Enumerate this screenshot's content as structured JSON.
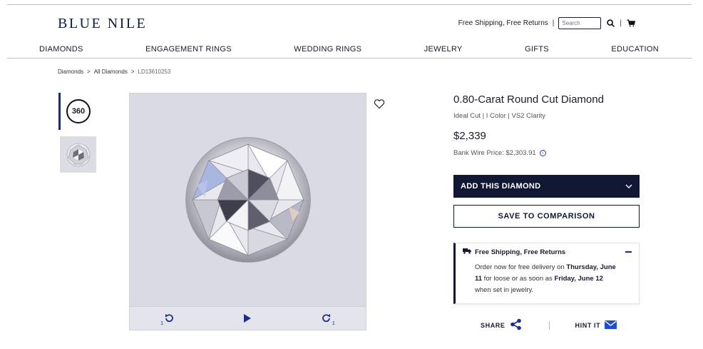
{
  "header": {
    "logo": "BLUE NILE",
    "shipping_link": "Free Shipping, Free Returns",
    "separator": "|",
    "search_placeholder": "Search"
  },
  "nav": {
    "items": [
      "DIAMONDS",
      "ENGAGEMENT RINGS",
      "WEDDING RINGS",
      "JEWELRY",
      "GIFTS",
      "EDUCATION"
    ]
  },
  "breadcrumb": {
    "items": [
      "Diamonds",
      "All Diamonds",
      "LD13610253"
    ],
    "separator": ">"
  },
  "gallery": {
    "badge_360": "360",
    "rotate_left_sub": "1",
    "rotate_right_sub": "1"
  },
  "product": {
    "title": "0.80-Carat Round Cut Diamond",
    "specs": "Ideal Cut | I Color | VS2 Clarity",
    "price": "$2,339",
    "bank_wire": "Bank Wire Price: $2,303.91",
    "info_glyph": "i"
  },
  "actions": {
    "add_label": "ADD THIS DIAMOND",
    "compare_label": "SAVE TO COMPARISON"
  },
  "shipping": {
    "title": "Free Shipping, Free Returns",
    "text_1": "Order now for free delivery on ",
    "date_1": "Thursday, June 11",
    "text_2": " for loose or as soon as ",
    "date_2": "Friday, June 12",
    "text_3": " when set in jewelry."
  },
  "share": {
    "share_label": "SHARE",
    "hint_label": "HINT IT"
  },
  "colors": {
    "navy": "#111733",
    "accent_blue": "#1f2b8e",
    "viewer_bg": "#d9dae3"
  },
  "icons": [
    "heart-icon",
    "search-icon",
    "cart-icon",
    "rotate-left-icon",
    "play-icon",
    "rotate-right-icon",
    "truck-icon",
    "share-icon",
    "envelope-icon",
    "chevron-down-icon",
    "info-icon"
  ]
}
